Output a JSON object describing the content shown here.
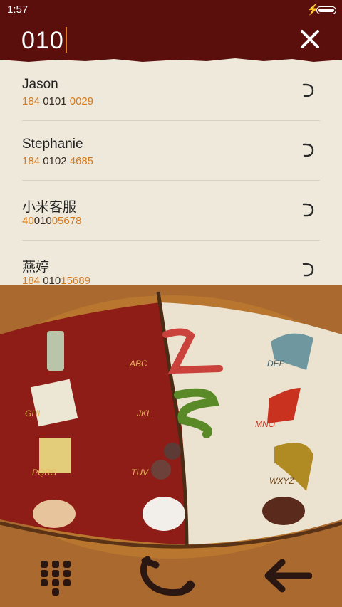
{
  "status": {
    "time": "1:57",
    "charging_icon": "bolt-icon",
    "battery_icon": "battery-icon"
  },
  "search": {
    "query": "010"
  },
  "results": [
    {
      "name": "Jason",
      "pre": "184 ",
      "match": "0101",
      "post": " 0029",
      "action_icon": "call-ring-icon"
    },
    {
      "name": "Stephanie",
      "pre": "184 ",
      "match": "0102",
      "post": " 4685",
      "action_icon": "call-ring-icon"
    },
    {
      "name": "小米客服",
      "pre": "40",
      "match": "010",
      "post": "05678",
      "action_icon": "call-ring-icon"
    },
    {
      "name": "燕婷",
      "pre": "184 ",
      "match": "010",
      "post": "15689",
      "action_icon": "call-ring-icon"
    }
  ],
  "keypad": {
    "k2": "ABC",
    "k3": "DEF",
    "k4": "GHI",
    "k5": "JKL",
    "k6": "MNO",
    "k7": "PQRS",
    "k8": "TUV",
    "k9": "WXYZ"
  },
  "bottom": {
    "keypad_icon": "keypad-grid-icon",
    "call_icon": "phone-icon",
    "back_icon": "back-arrow-icon"
  }
}
